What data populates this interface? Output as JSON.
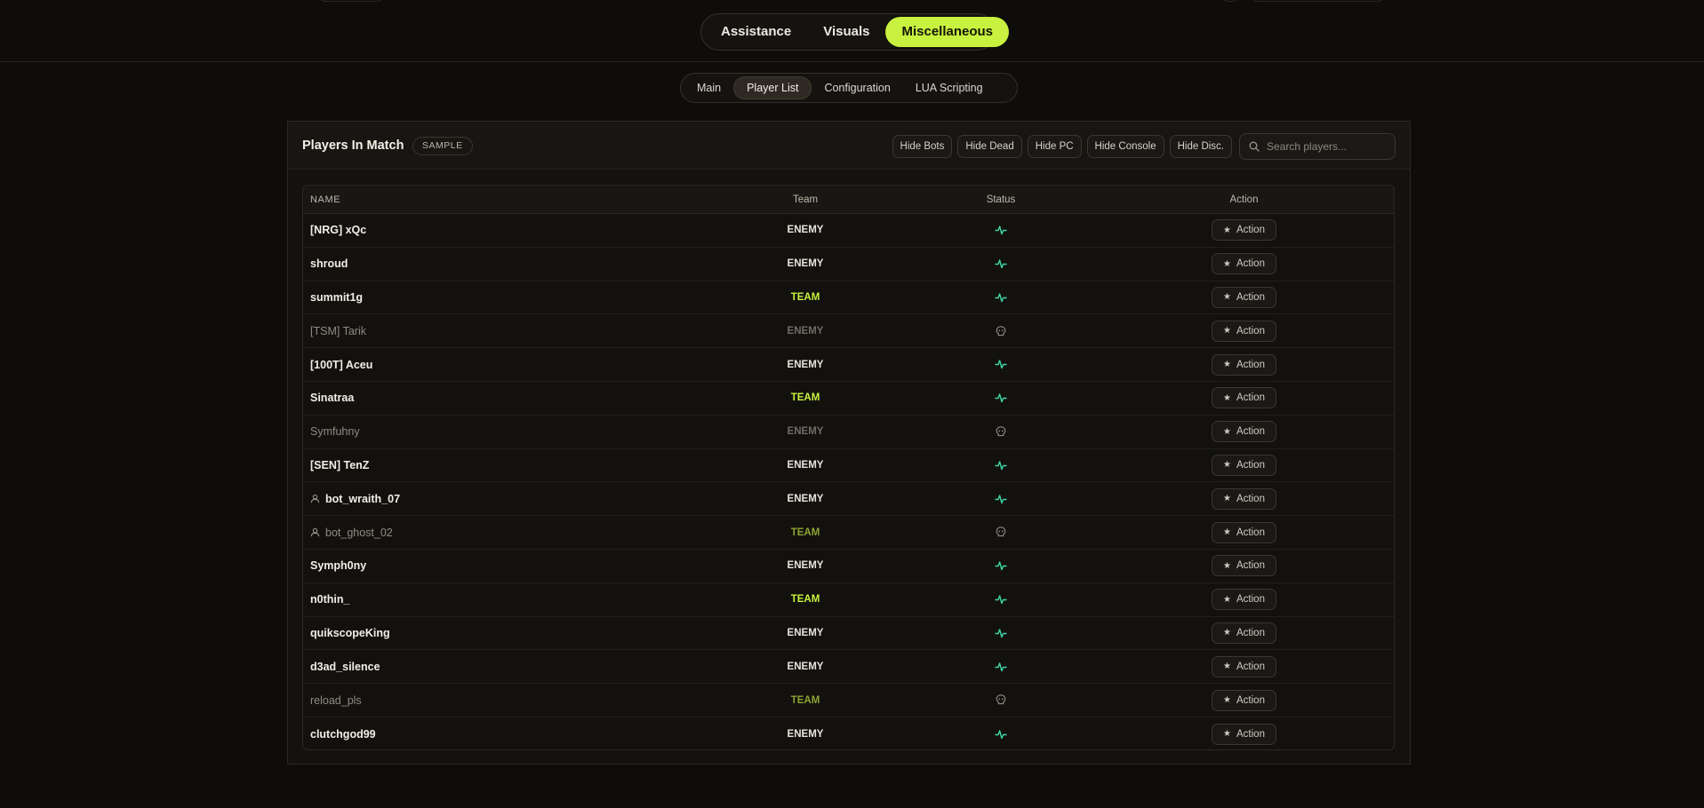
{
  "main_tabs": [
    {
      "label": "Assistance",
      "active": false
    },
    {
      "label": "Visuals",
      "active": false
    },
    {
      "label": "Miscellaneous",
      "active": true
    }
  ],
  "sub_tabs": [
    {
      "label": "Main",
      "active": false
    },
    {
      "label": "Player List",
      "active": true
    },
    {
      "label": "Configuration",
      "active": false
    },
    {
      "label": "LUA Scripting",
      "active": false
    }
  ],
  "panel": {
    "title": "Players In Match",
    "badge": "SAMPLE",
    "filters": [
      "Hide Bots",
      "Hide Dead",
      "Hide PC",
      "Hide Console",
      "Hide Disc."
    ],
    "search_placeholder": "Search players..."
  },
  "table": {
    "columns": {
      "name": "NAME",
      "team": "Team",
      "status": "Status",
      "action": "Action"
    },
    "action_label": "Action",
    "rows": [
      {
        "name": "[NRG] xQc",
        "team": "ENEMY",
        "status": "alive",
        "bot": false,
        "dim": false
      },
      {
        "name": "shroud",
        "team": "ENEMY",
        "status": "alive",
        "bot": false,
        "dim": false
      },
      {
        "name": "summit1g",
        "team": "TEAM",
        "status": "alive",
        "bot": false,
        "dim": false
      },
      {
        "name": "[TSM] Tarik",
        "team": "ENEMY",
        "status": "dead",
        "bot": false,
        "dim": true
      },
      {
        "name": "[100T] Aceu",
        "team": "ENEMY",
        "status": "alive",
        "bot": false,
        "dim": false
      },
      {
        "name": "Sinatraa",
        "team": "TEAM",
        "status": "alive",
        "bot": false,
        "dim": false
      },
      {
        "name": "Symfuhny",
        "team": "ENEMY",
        "status": "dead",
        "bot": false,
        "dim": true
      },
      {
        "name": "[SEN] TenZ",
        "team": "ENEMY",
        "status": "alive",
        "bot": false,
        "dim": false
      },
      {
        "name": "bot_wraith_07",
        "team": "ENEMY",
        "status": "alive",
        "bot": true,
        "dim": false
      },
      {
        "name": "bot_ghost_02",
        "team": "TEAM",
        "status": "dead",
        "bot": true,
        "dim": true
      },
      {
        "name": "Symph0ny",
        "team": "ENEMY",
        "status": "alive",
        "bot": false,
        "dim": false
      },
      {
        "name": "n0thin_",
        "team": "TEAM",
        "status": "alive",
        "bot": false,
        "dim": false
      },
      {
        "name": "quikscopeKing",
        "team": "ENEMY",
        "status": "alive",
        "bot": false,
        "dim": false
      },
      {
        "name": "d3ad_silence",
        "team": "ENEMY",
        "status": "alive",
        "bot": false,
        "dim": false
      },
      {
        "name": "reload_pls",
        "team": "TEAM",
        "status": "dead",
        "bot": false,
        "dim": true
      },
      {
        "name": "clutchgod99",
        "team": "ENEMY",
        "status": "alive",
        "bot": false,
        "dim": false
      }
    ]
  },
  "colors": {
    "accent": "#c8f23f",
    "alive": "#3fd6a8",
    "dead": "#8f8b82",
    "background": "#0e0d0b"
  },
  "icons": {
    "alive": "heartbeat-icon",
    "dead": "skull-icon",
    "bot": "user-icon",
    "search": "search-icon",
    "action": "star-icon"
  }
}
